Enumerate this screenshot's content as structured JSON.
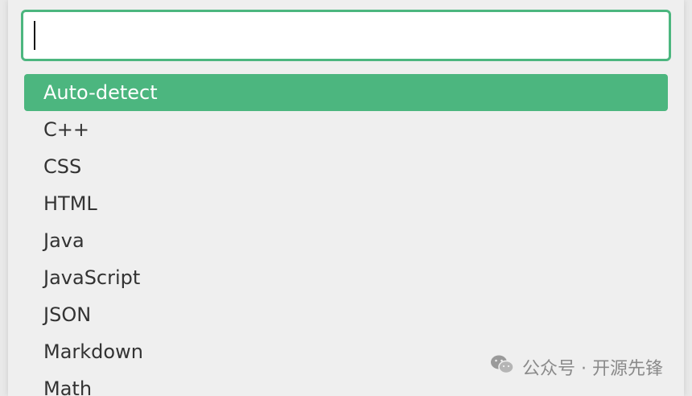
{
  "search": {
    "value": "",
    "placeholder": ""
  },
  "languages": {
    "selected_index": 0,
    "items": [
      "Auto-detect",
      "C++",
      "CSS",
      "HTML",
      "Java",
      "JavaScript",
      "JSON",
      "Markdown",
      "Math"
    ]
  },
  "watermark": {
    "text": "公众号 · 开源先锋",
    "icon": "wechat-icon"
  },
  "colors": {
    "accent": "#4cb67f",
    "background": "#efefef",
    "text": "#333333"
  }
}
